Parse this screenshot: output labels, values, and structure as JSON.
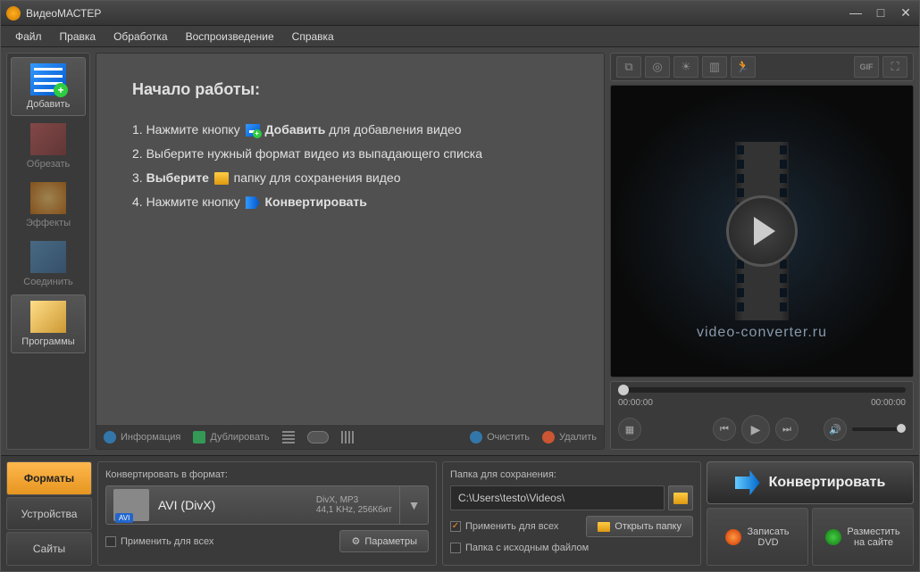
{
  "titlebar": {
    "title": "ВидеоМАСТЕР"
  },
  "menubar": {
    "items": [
      "Файл",
      "Правка",
      "Обработка",
      "Воспроизведение",
      "Справка"
    ]
  },
  "sidebar": {
    "items": [
      {
        "label": "Добавить",
        "active": true
      },
      {
        "label": "Обрезать",
        "disabled": true
      },
      {
        "label": "Эффекты",
        "disabled": true
      },
      {
        "label": "Соединить",
        "disabled": true
      },
      {
        "label": "Программы",
        "active": true
      }
    ]
  },
  "content": {
    "title": "Начало работы:",
    "step1_a": "1. Нажмите кнопку ",
    "step1_b": "Добавить",
    "step1_c": " для добавления видео",
    "step2": "2. Выберите нужный формат видео из выпадающего списка",
    "step3_a": "3. ",
    "step3_b": "Выберите",
    "step3_c": " папку для сохранения видео",
    "step4_a": "4. Нажмите кнопку ",
    "step4_b": "Конвертировать"
  },
  "toolbar": {
    "info": "Информация",
    "duplicate": "Дублировать",
    "clear": "Очистить",
    "delete": "Удалить"
  },
  "preview": {
    "watermark": "video-converter.ru",
    "time_start": "00:00:00",
    "time_end": "00:00:00"
  },
  "format_tabs": {
    "items": [
      "Форматы",
      "Устройства",
      "Сайты"
    ]
  },
  "format": {
    "section_label": "Конвертировать в формат:",
    "name": "AVI (DivX)",
    "badge": "AVI",
    "detail1": "DivX, MP3",
    "detail2": "44,1 KHz, 256Кбит",
    "apply_all": "Применить для всех",
    "params": "Параметры"
  },
  "folder": {
    "section_label": "Папка для сохранения:",
    "path": "C:\\Users\\testo\\Videos\\",
    "apply_all": "Применить для всех",
    "same_folder": "Папка с исходным файлом",
    "open": "Открыть папку"
  },
  "actions": {
    "convert": "Конвертировать",
    "dvd_line1": "Записать",
    "dvd_line2": "DVD",
    "publish_line1": "Разместить",
    "publish_line2": "на сайте"
  }
}
